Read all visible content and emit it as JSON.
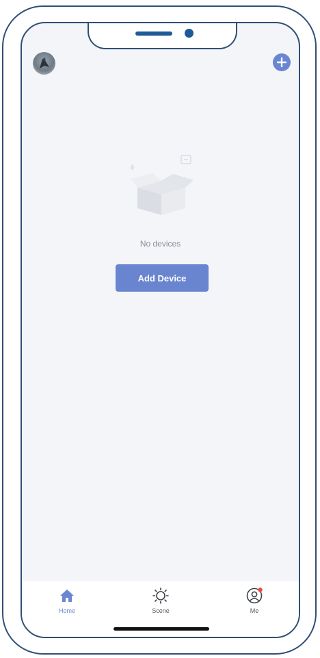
{
  "empty_state": {
    "message": "No devices",
    "button_label": "Add Device"
  },
  "tabs": [
    {
      "label": "Home",
      "icon": "home-icon",
      "active": true
    },
    {
      "label": "Scene",
      "icon": "sun-icon",
      "active": false
    },
    {
      "label": "Me",
      "icon": "user-icon",
      "active": false,
      "badge": true
    }
  ],
  "colors": {
    "accent": "#6985d0",
    "background": "#f4f5f9",
    "badge": "#e84a4a"
  }
}
